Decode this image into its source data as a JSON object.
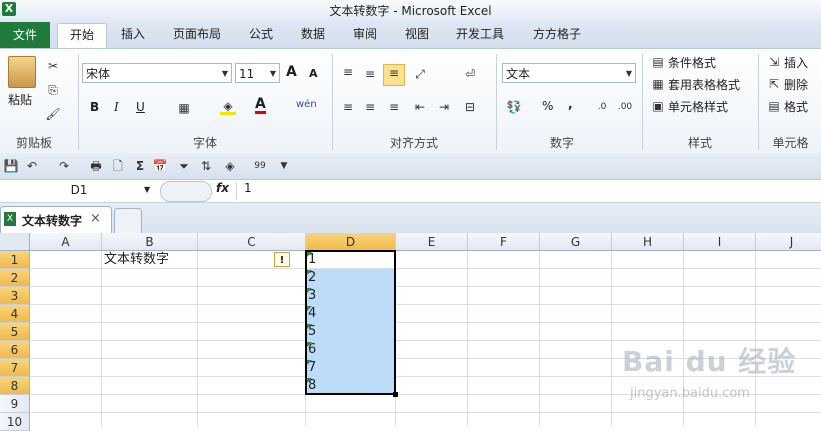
{
  "window": {
    "title": "文本转数字 - Microsoft Excel",
    "app_icon": "X"
  },
  "ribbon_tabs": [
    "文件",
    "开始",
    "插入",
    "页面布局",
    "公式",
    "数据",
    "审阅",
    "视图",
    "开发工具",
    "方方格子"
  ],
  "ribbon": {
    "clipboard": {
      "paste_label": "粘贴",
      "group_label": "剪贴板"
    },
    "font": {
      "font_name": "宋体",
      "font_size": "11",
      "bold": "B",
      "italic": "I",
      "underline": "U",
      "grow": "A",
      "shrink": "A",
      "font_color_letter": "A",
      "wen": "wén",
      "group_label": "字体"
    },
    "alignment": {
      "group_label": "对齐方式"
    },
    "number": {
      "format": "文本",
      "percent": "%",
      "comma": ",",
      "group_label": "数字"
    },
    "styles": {
      "conditional": "条件格式",
      "table_format": "套用表格格式",
      "cell_styles": "单元格样式",
      "group_label": "样式"
    },
    "cells": {
      "insert": "插入",
      "delete": "删除",
      "format": "格式",
      "group_label": "单元格"
    }
  },
  "formula_bar": {
    "name_box": "D1",
    "fx": "fx",
    "content": "1"
  },
  "workbook_tab": {
    "name": "文本转数字",
    "close": "×"
  },
  "grid": {
    "columns": [
      "A",
      "B",
      "C",
      "D",
      "E",
      "F",
      "G",
      "H",
      "I",
      "J"
    ],
    "rows": [
      "1",
      "2",
      "3",
      "4",
      "5",
      "6",
      "7",
      "8",
      "9",
      "10"
    ],
    "b1": "文本转数字",
    "d_values": [
      "1",
      "2",
      "3",
      "4",
      "5",
      "6",
      "7",
      "8"
    ],
    "warning_icon": "!"
  },
  "watermark": {
    "text": "Bai du 经验",
    "sub": "jingyan.baidu.com"
  }
}
